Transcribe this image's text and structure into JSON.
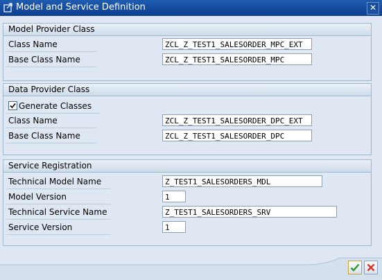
{
  "window": {
    "title": "Model and Service Definition",
    "close_label": "✕"
  },
  "model_provider": {
    "header": "Model Provider Class",
    "class_name_label": "Class Name",
    "class_name_value": "ZCL_Z_TEST1_SALESORDER_MPC_EXT",
    "base_class_label": "Base Class Name",
    "base_class_value": "ZCL_Z_TEST1_SALESORDER_MPC"
  },
  "data_provider": {
    "header": "Data Provider Class",
    "generate_label": "Generate Classes",
    "generate_checked": true,
    "class_name_label": "Class Name",
    "class_name_value": "ZCL_Z_TEST1_SALESORDER_DPC_EXT",
    "base_class_label": "Base Class Name",
    "base_class_value": "ZCL_Z_TEST1_SALESORDER_DPC"
  },
  "service_registration": {
    "header": "Service Registration",
    "tech_model_label": "Technical Model Name",
    "tech_model_value": "Z_TEST1_SALESORDERS_MDL",
    "model_version_label": "Model Version",
    "model_version_value": "1",
    "tech_service_label": "Technical Service Name",
    "tech_service_value": "Z_TEST1_SALESORDERS_SRV",
    "service_version_label": "Service Version",
    "service_version_value": "1"
  },
  "buttons": {
    "confirm_icon": "checkmark-icon",
    "cancel_icon": "cancel-x-icon"
  },
  "colors": {
    "titlebar": "#1f5cb0",
    "background": "#dfe8f2",
    "confirm": "#2e9a2e",
    "cancel": "#d8322a"
  }
}
